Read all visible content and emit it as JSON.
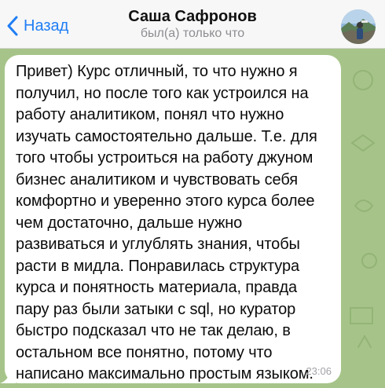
{
  "header": {
    "back_label": "Назад",
    "contact_name": "Саша Сафронов",
    "status": "был(а) только что"
  },
  "message": {
    "text": "Привет) Курс отличный, то что нужно я\nполучил, но после того как устроился на\nработу аналитиком, понял что нужно\nизучать самостоятельно дальше. Т.е. для\nтого чтобы устроиться на работу джуном\nбизнес аналитиком и чувствовать себя\nкомфортно и уверенно этого курса более\nчем достаточно, дальше нужно\nразвиваться и углублять знания, чтобы\nрасти в мидла. Понравилась структура\nкурса и понятность материала, правда\nпару раз были затыки с sql, но куратор\nбыстро подсказал что не так делаю, в\nостальном все понятно, потому что\nнаписано максимально простым языком.",
    "time": "23:06"
  },
  "colors": {
    "accent": "#1f7ef5",
    "chat_background": "#a6c489",
    "bubble": "#ffffff"
  },
  "icons": {
    "back": "chevron-left-icon",
    "avatar": "profile-photo"
  }
}
